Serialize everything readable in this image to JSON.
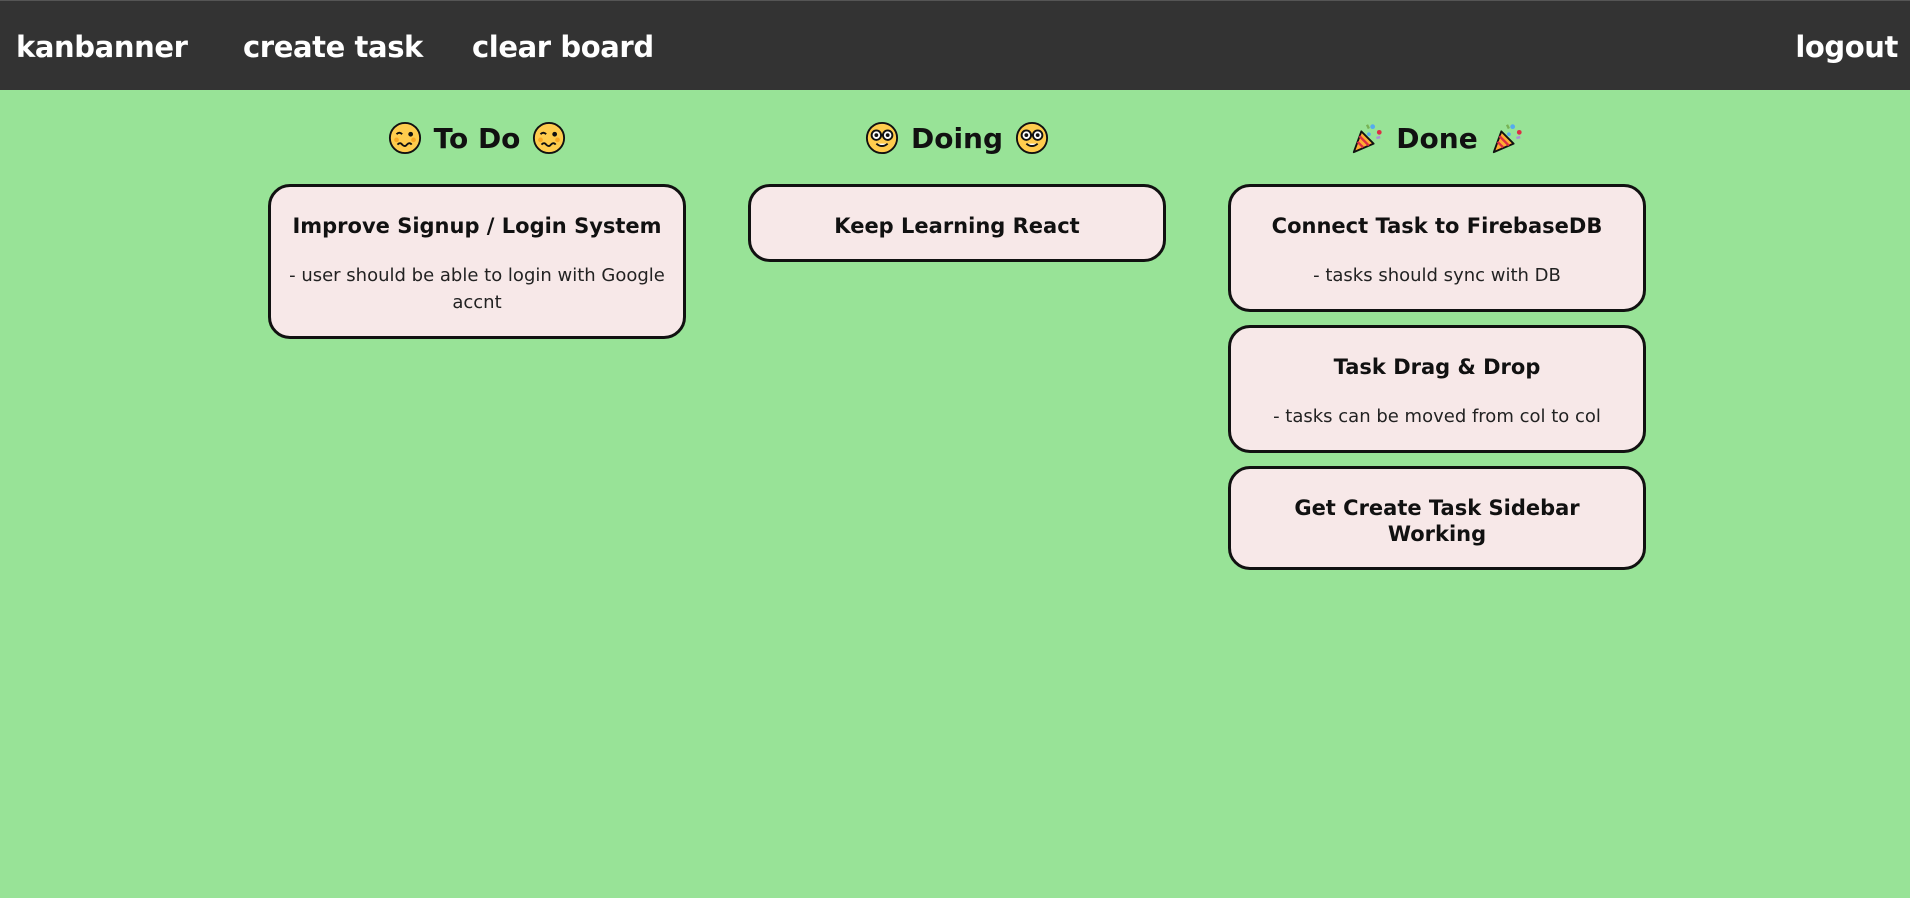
{
  "navbar": {
    "brand": "kanbanner",
    "create_task": "create task",
    "clear_board": "clear board",
    "logout": "logout"
  },
  "columns": [
    {
      "title": "To Do",
      "icon": "woozy-face-icon",
      "cards": [
        {
          "title": "Improve Signup / Login System",
          "description": "- user should be able to login with Google accnt"
        }
      ]
    },
    {
      "title": "Doing",
      "icon": "nerd-face-icon",
      "cards": [
        {
          "title": "Keep Learning React",
          "description": ""
        }
      ]
    },
    {
      "title": "Done",
      "icon": "party-popper-icon",
      "cards": [
        {
          "title": "Connect Task to FirebaseDB",
          "description": "- tasks should sync with DB"
        },
        {
          "title": "Task Drag & Drop",
          "description": "- tasks can be moved from col to col"
        },
        {
          "title": "Get Create Task Sidebar Working",
          "description": ""
        }
      ]
    }
  ],
  "colors": {
    "navbar_bg": "#333333",
    "board_bg": "#98e397",
    "card_bg": "#f7e8e8",
    "card_border": "#111111"
  }
}
